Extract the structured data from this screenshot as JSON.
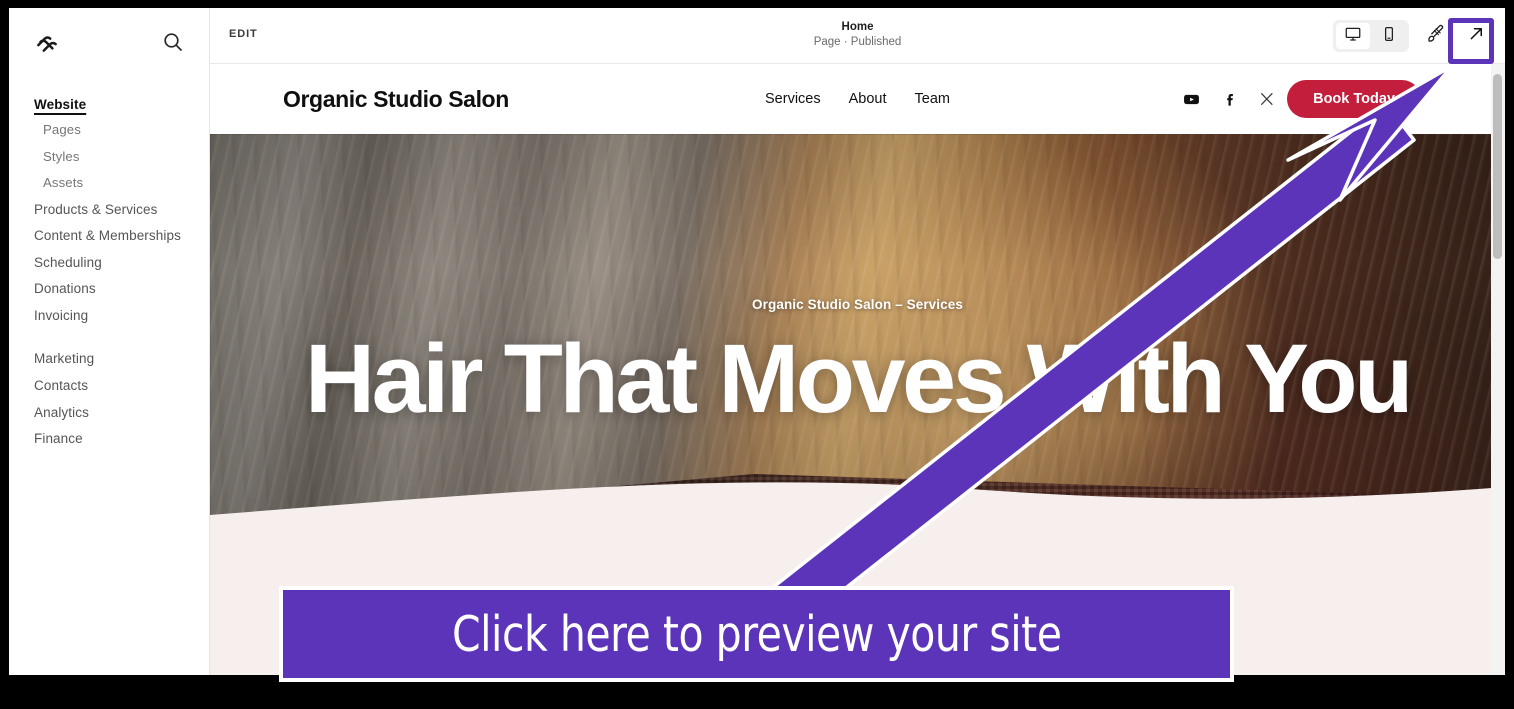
{
  "sidebar": {
    "logo_icon": "squarespace-logo-icon",
    "search_icon": "search-icon",
    "items": [
      {
        "label": "Website",
        "level": "top"
      },
      {
        "label": "Pages",
        "level": "sub"
      },
      {
        "label": "Styles",
        "level": "sub"
      },
      {
        "label": "Assets",
        "level": "sub"
      },
      {
        "label": "Products & Services",
        "level": "section"
      },
      {
        "label": "Content & Memberships",
        "level": "section"
      },
      {
        "label": "Scheduling",
        "level": "section"
      },
      {
        "label": "Donations",
        "level": "section"
      },
      {
        "label": "Invoicing",
        "level": "section"
      },
      {
        "label": "Marketing",
        "level": "section"
      },
      {
        "label": "Contacts",
        "level": "section"
      },
      {
        "label": "Analytics",
        "level": "section"
      },
      {
        "label": "Finance",
        "level": "section"
      }
    ]
  },
  "toolbar": {
    "edit_label": "EDIT",
    "page_title": "Home",
    "page_status": "Page · Published",
    "desktop_icon": "desktop-icon",
    "mobile_icon": "mobile-icon",
    "brush_icon": "paintbrush-icon",
    "preview_icon": "open-in-new-arrow-icon"
  },
  "site": {
    "brand": "Organic Studio Salon",
    "nav": [
      "Services",
      "About",
      "Team"
    ],
    "social": [
      "youtube-icon",
      "facebook-icon",
      "x-twitter-icon"
    ],
    "cta_label": "Book Today",
    "cta_color": "#c31f3c",
    "hero_eyebrow": "Organic Studio Salon – Services",
    "hero_title": "Hair That Moves With You"
  },
  "annotation": {
    "callout_text": "Click here to preview your site",
    "accent_color": "#5b34ba",
    "arrow_name": "purple-pointer-arrow"
  }
}
